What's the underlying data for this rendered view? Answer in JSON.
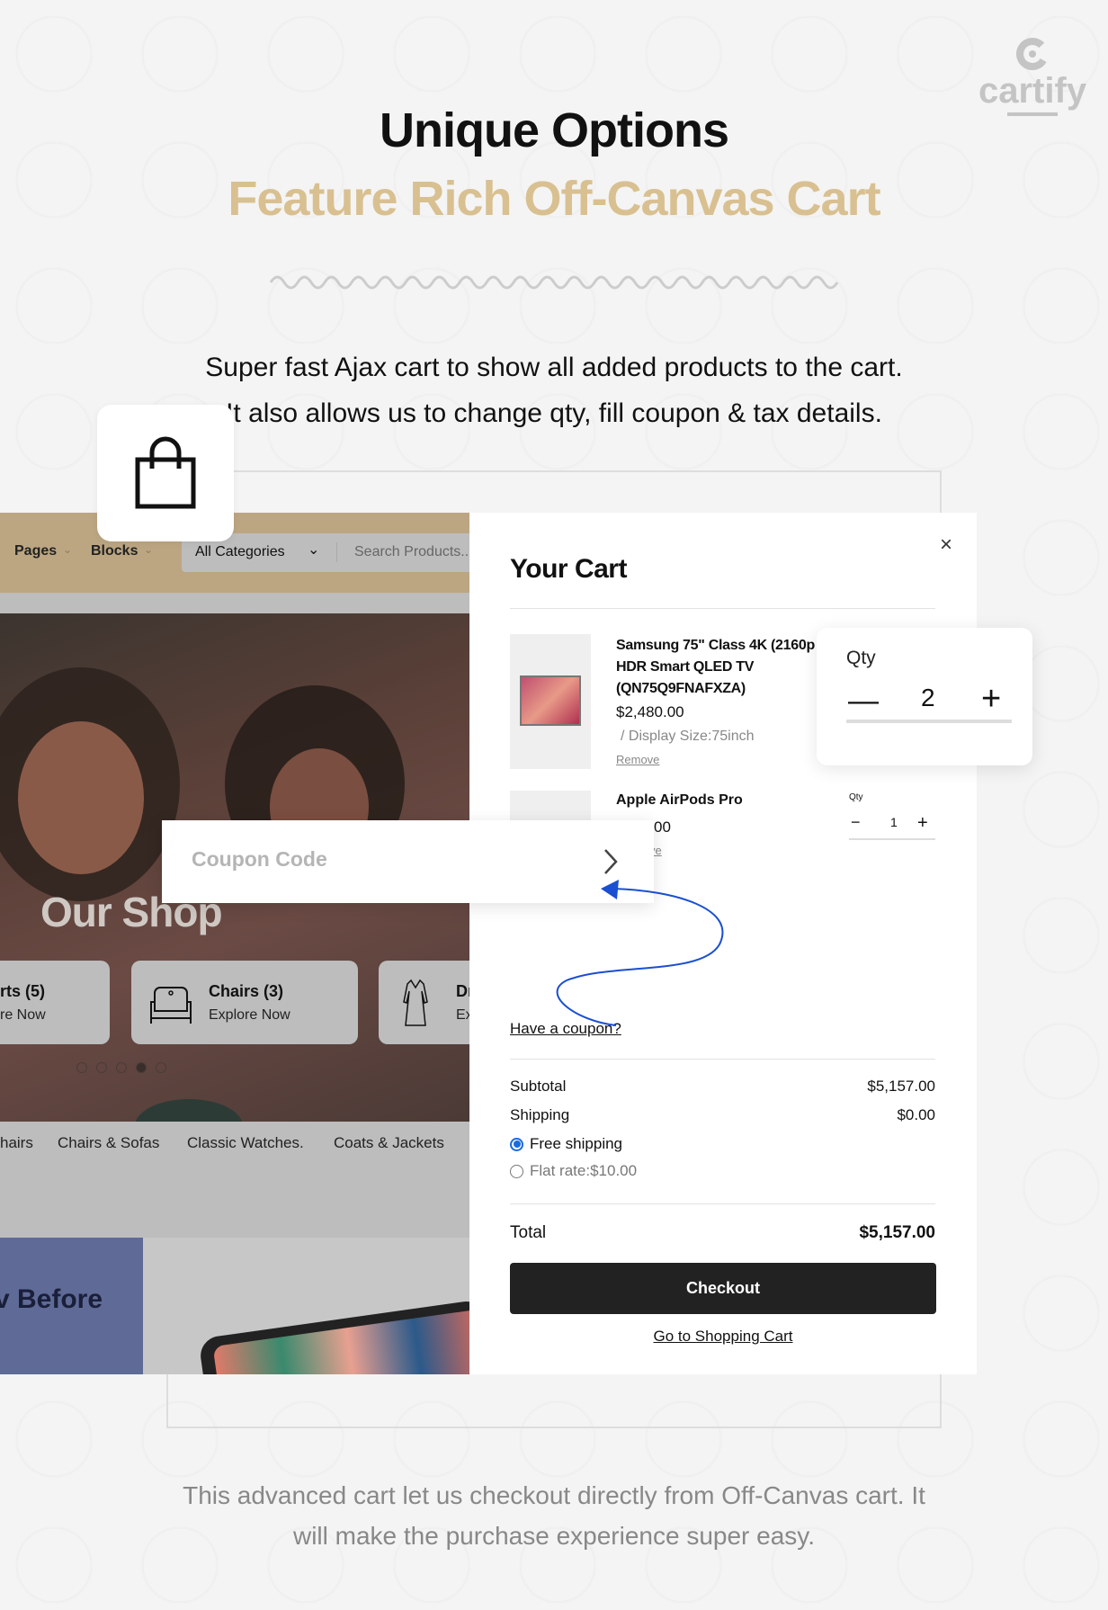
{
  "logo": {
    "text": "cartify"
  },
  "header": {
    "title": "Unique Options",
    "subtitle": "Feature Rich Off-Canvas Cart",
    "subtitle_color": "#d9c091"
  },
  "intro": {
    "line1": "Super fast Ajax cart to show all added products to the cart.",
    "line2": "It also allows us to change qty,  fill coupon & tax details."
  },
  "shop": {
    "nav": {
      "pages": "Pages",
      "blocks": "Blocks",
      "category_select": "All Categories",
      "search_placeholder": "Search Products.."
    },
    "hero_title": "Our Shop",
    "category_cards": [
      {
        "title": "rts (5)",
        "cta": "re Now"
      },
      {
        "title": "Chairs (3)",
        "cta": "Explore Now"
      },
      {
        "title": "Dr",
        "cta": "Ex"
      }
    ],
    "carousel": {
      "dots": 5,
      "active": 4
    },
    "category_links": [
      "hairs",
      "Chairs & Sofas",
      "Classic Watches.",
      "Coats & Jackets"
    ],
    "banner_title": "v Before",
    "nav_color": "#bca682"
  },
  "cart": {
    "title": "Your Cart",
    "items": [
      {
        "name_lines": [
          "Samsung 75\" Class 4K (2160p",
          "HDR Smart QLED TV",
          "(QN75Q9FNAFXZA)"
        ],
        "price": "$2,480.00",
        "variant": "/ Display Size:75inch",
        "remove": "Remove",
        "qty_label": "Qty",
        "qty": "2"
      },
      {
        "name": "Apple AirPods Pro",
        "price": "00",
        "remove": "ve",
        "qty_label": "Qty",
        "qty": "1"
      }
    ],
    "coupon_link": "Have a coupon?",
    "coupon_placeholder": "Coupon Code",
    "subtotal_label": "Subtotal",
    "subtotal": "$5,157.00",
    "shipping_label": "Shipping",
    "shipping": "$0.00",
    "shipping_options": [
      {
        "label": "Free shipping",
        "selected": true
      },
      {
        "label": "Flat rate:$10.00",
        "selected": false
      }
    ],
    "total_label": "Total",
    "total": "$5,157.00",
    "checkout": "Checkout",
    "go_to_cart": "Go to Shopping Cart",
    "accent": "#1a6be0"
  },
  "footer": {
    "line1": "This advanced cart let us checkout directly from Off-Canvas cart. It",
    "line2": "will make the purchase experience super easy."
  }
}
